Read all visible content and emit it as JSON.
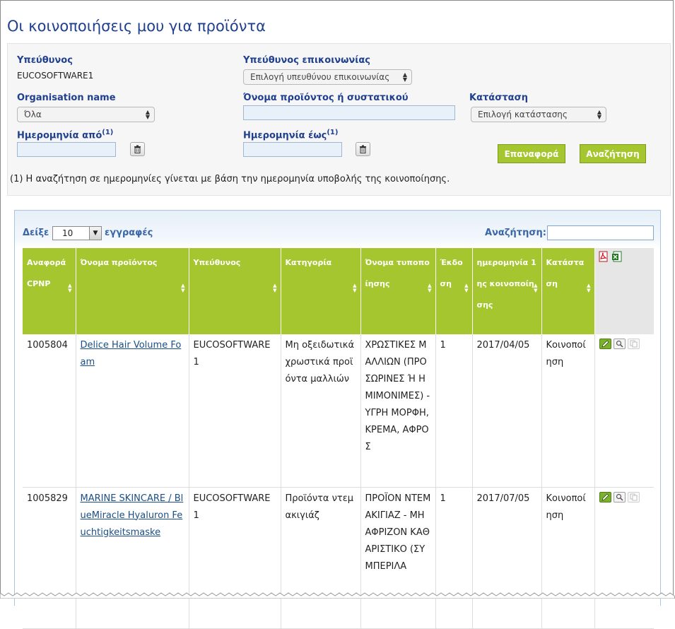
{
  "page": {
    "title": "Οι κοινοποιήσεις μου για προϊόντα"
  },
  "filters": {
    "responsible_label": "Υπεύθυνος",
    "responsible_value": "EUCOSOFTWARE1",
    "contact_label": "Υπεύθυνος επικοινωνίας",
    "contact_select": "Επιλογή υπευθύνου επικοινωνίας",
    "org_label": "Organisation name",
    "org_select": "Όλα",
    "product_label": "Όνομα προϊόντος ή συστατικού",
    "product_value": "",
    "status_label": "Κατάσταση",
    "status_select": "Επιλογή κατάστασης",
    "date_from_label": "Ημερομηνία από",
    "date_to_label": "Ημερομηνία έως",
    "footnote_mark": "(1)",
    "date_from_value": "",
    "date_to_value": "",
    "reset_button": "Επαναφορά",
    "search_button": "Αναζήτηση",
    "note": "(1) Η αναζήτηση σε ημερομηνίες γίνεται με βάση την ημερομηνία υποβολής της κοινοποίησης."
  },
  "results": {
    "show_label": "Δείξε",
    "page_length": "10",
    "records_label": "εγγραφές",
    "search_label": "Αναζήτηση:",
    "search_value": "",
    "columns": [
      "Αναφορά CPNP",
      "Όνομα προϊόντος",
      "Υπεύθυνος",
      "Κατηγορία",
      "Όνομα τυποποίησης",
      "Έκδοση",
      "ημερομηνία 1ης κοινοποίησης",
      "Κατάσταση"
    ],
    "rows": [
      {
        "cpnp": "1005804",
        "product": "Delice Hair Volume Foam",
        "responsible": "EUCOSOFTWARE1",
        "category": "Μη οξειδωτικά χρωστικά προϊόντα μαλλιών",
        "formulation": "ΧΡΩΣΤΙΚΕΣ ΜΑΛΛΙΩΝ (ΠΡΟΣΩΡΙΝΕΣ Ή ΗΜΙΜΟΝΙΜΕΣ) - ΥΓΡΗ ΜΟΡΦΗ, ΚΡΕΜΑ, ΑΦΡΟΣ",
        "version": "1",
        "first_date": "2017/04/05",
        "status": "Κοινοποίηση"
      },
      {
        "cpnp": "1005829",
        "product": "MARINE SKINCARE / BlueMiracle Hyaluron Feuchtigkeitsmaske",
        "responsible": "EUCOSOFTWARE1",
        "category": "Προϊόντα ντεμακιγιάζ",
        "formulation": "ΠΡΟΪΟΝ ΝΤΕΜΑΚΙΓΙΑΖ - ΜΗ ΑΦΡΙΖΟΝ ΚΑΘΑΡΙΣΤΙΚΟ (ΣΥΜΠΕΡΙΛΑ",
        "version": "1",
        "first_date": "2017/07/05",
        "status": "Κοινοποίηση"
      }
    ]
  },
  "icons": {
    "pdf": "pdf-export-icon",
    "excel": "excel-export-icon",
    "edit": "edit-icon",
    "view": "magnifier-icon",
    "copy": "copy-icon",
    "trash": "trash-icon"
  },
  "colors": {
    "title": "#1f3f8f",
    "header_green": "#a6c630",
    "link": "#1a4f86"
  }
}
